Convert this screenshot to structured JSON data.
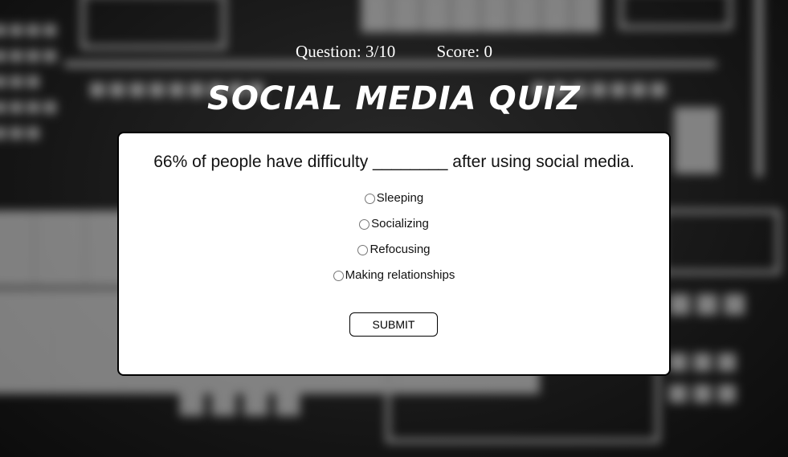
{
  "header": {
    "question_label": "Question: 3/10",
    "score_label": "Score: 0"
  },
  "title": "SOCIAL MEDIA QUIZ",
  "quiz": {
    "question": "66% of people have difficulty ________ after using social media.",
    "options": [
      {
        "label": "Sleeping",
        "selected": false
      },
      {
        "label": "Socializing",
        "selected": false
      },
      {
        "label": "Refocusing",
        "selected": false
      },
      {
        "label": "Making relationships",
        "selected": false
      }
    ],
    "submit_label": "SUBMIT"
  },
  "colors": {
    "page_background": "#1a1a1a",
    "card_background": "#ffffff",
    "text_light": "#ffffff",
    "text_dark": "#111111"
  }
}
